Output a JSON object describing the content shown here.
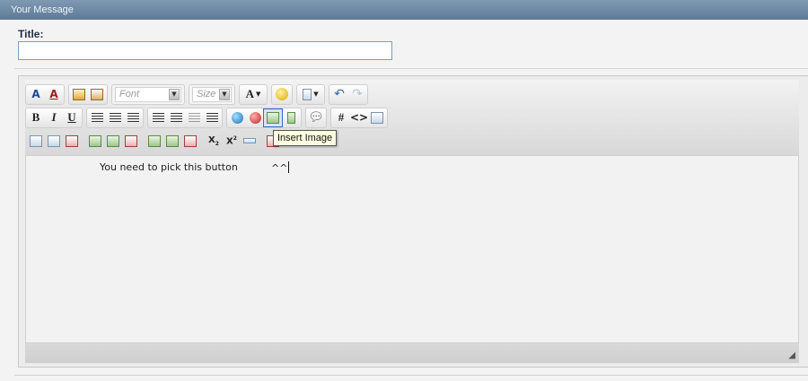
{
  "header": {
    "title": "Your Message"
  },
  "form": {
    "title_label": "Title:",
    "title_value": ""
  },
  "toolbar": {
    "font_placeholder": "Font",
    "size_placeholder": "Size",
    "text_color_label": "A",
    "bold_label": "B",
    "italic_label": "I",
    "underline_label": "U",
    "hash_label": "#",
    "code_label": "<>",
    "subscript_label": "X",
    "superscript_label": "X",
    "superscript_exp": "2"
  },
  "tooltip": {
    "text": "Insert Image"
  },
  "editor": {
    "line_text": "You need to pick this button",
    "pointer_text": "^^"
  },
  "colors": {
    "header_bg": "#6b86a2",
    "hover_outline": "#316ac5",
    "tooltip_bg": "#ffffe1"
  }
}
